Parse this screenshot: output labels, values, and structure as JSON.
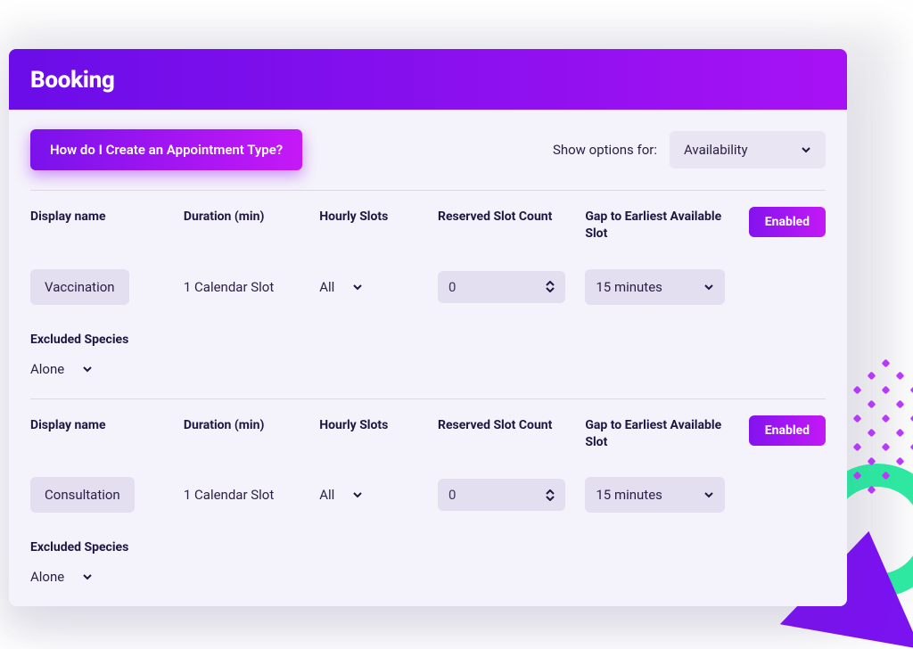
{
  "header": {
    "title": "Booking"
  },
  "top": {
    "help_button": "How do I Create an Appointment Type?",
    "show_options_label": "Show options for:",
    "show_options_value": "Availability"
  },
  "columns": {
    "display_name": "Display name",
    "duration": "Duration (min)",
    "hourly_slots": "Hourly Slots",
    "reserved_count": "Reserved Slot Count",
    "gap": "Gap to Earliest Available Slot",
    "excluded": "Excluded Species"
  },
  "rows": [
    {
      "display_name": "Vaccination",
      "duration": "1 Calendar Slot",
      "hourly_slots": "All",
      "reserved_count": "0",
      "gap": "15 minutes",
      "enabled_label": "Enabled",
      "excluded_value": "Alone"
    },
    {
      "display_name": "Consultation",
      "duration": "1 Calendar Slot",
      "hourly_slots": "All",
      "reserved_count": "0",
      "gap": "15 minutes",
      "enabled_label": "Enabled",
      "excluded_value": "Alone"
    }
  ]
}
